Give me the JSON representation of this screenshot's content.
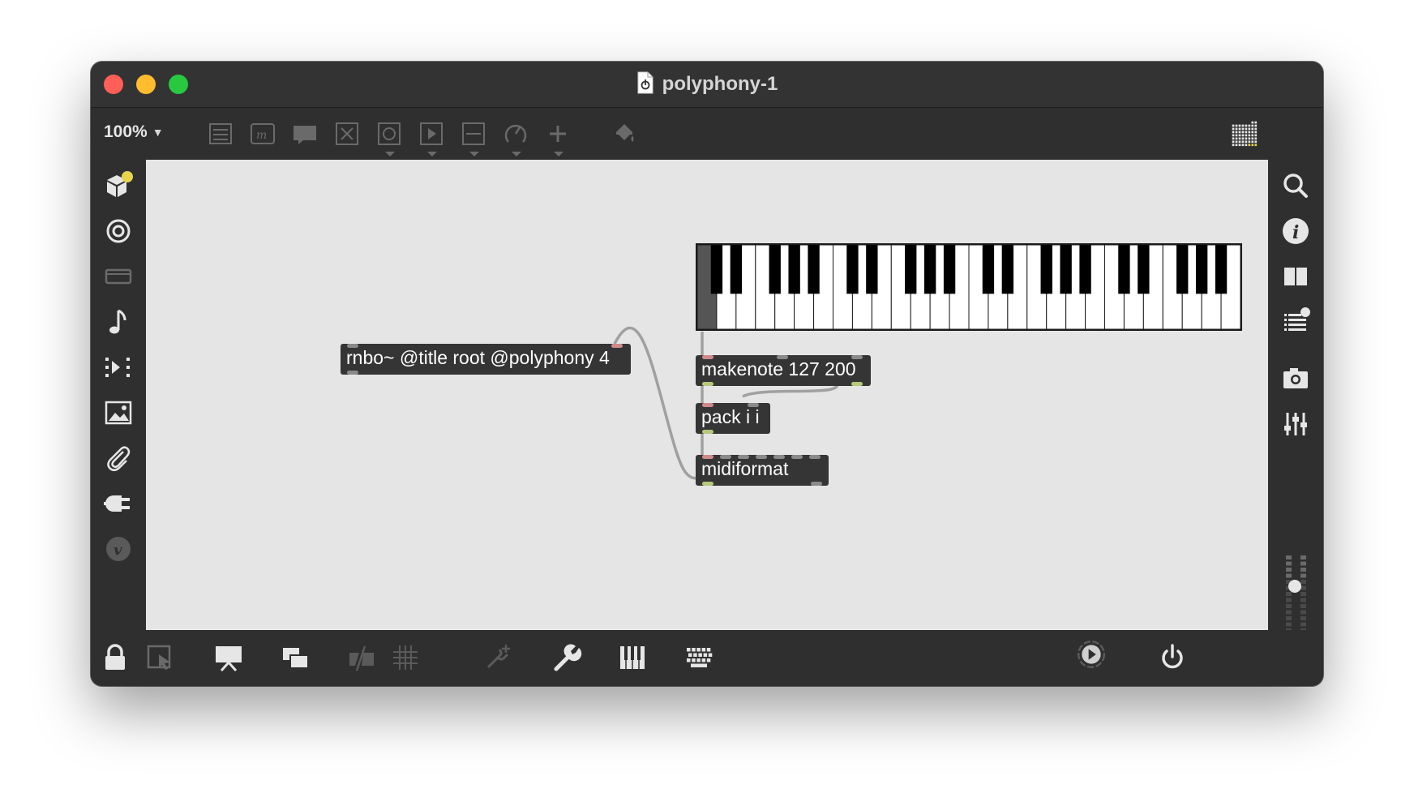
{
  "window": {
    "title": "polyphony-1",
    "title_icon": "max-patcher-file-icon"
  },
  "toolbar": {
    "zoom": "100%",
    "zoom_caret": "▼",
    "icons": [
      "list-object-icon",
      "message-object-icon",
      "comment-icon",
      "toggle-icon",
      "button-icon",
      "playbar-icon",
      "slider-icon",
      "dial-icon",
      "add-icon",
      "paint-bucket-icon",
      "grid-keyboard-icon"
    ]
  },
  "left_sidebar": {
    "icons": [
      "packages-icon",
      "audio-target-icon",
      "media-icon",
      "music-note-icon",
      "sequencer-icon",
      "image-icon",
      "paperclip-icon",
      "plug-icon",
      "vimeo-icon"
    ]
  },
  "right_sidebar": {
    "icons": [
      "search-icon",
      "info-icon",
      "columns-icon",
      "list-icon",
      "camera-icon",
      "mixer-sliders-icon",
      "volume-meter"
    ]
  },
  "bottom_toolbar": {
    "icons": [
      "lock-icon",
      "select-arrow-icon",
      "presentation-icon",
      "windows-icon",
      "hide-icon",
      "grid-icon",
      "pin-icon",
      "wrench-icon",
      "piano-keys-icon",
      "keyboard-icon",
      "transport-play-icon",
      "power-icon"
    ]
  },
  "patcher": {
    "objects": {
      "rnbo": "rnbo~ @title root @polyphony 4",
      "makenote": "makenote 127 200",
      "pack": "pack i i",
      "midiformat": "midiformat"
    },
    "keyboard": {
      "white_keys": 28,
      "pressed_white_index": 0
    }
  },
  "colors": {
    "window_bg": "#2f2f2f",
    "canvas_bg": "#e5e5e5",
    "object_bg": "#353535",
    "patch_cord": "#a0a0a0",
    "badge_yellow": "#e8d44d"
  }
}
